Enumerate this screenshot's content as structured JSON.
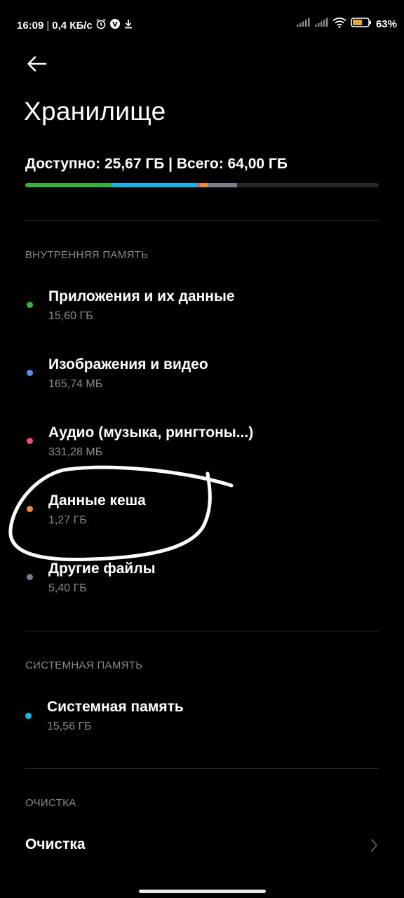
{
  "status_bar": {
    "time": "16:09",
    "speed": "0,4 КБ/с",
    "battery": "63%",
    "battery_level": 0.63,
    "icons": [
      "alarm-icon",
      "vpn-icon",
      "download-icon",
      "signal-icon",
      "signal-icon",
      "wifi-icon",
      "battery-icon"
    ]
  },
  "header": {
    "back_icon": "arrow-left-icon",
    "title": "Хранилище"
  },
  "storage": {
    "summary": "Доступно: 25,67 ГБ | Всего: 64,00 ГБ",
    "bar_segments": [
      {
        "label": "Приложения и их данные",
        "fraction": 0.244,
        "color": "#3aaf3e"
      },
      {
        "label": "Системная память",
        "fraction": 0.243,
        "color": "#19b6e9"
      },
      {
        "label": "Аудио (музыка, рингтоны...)",
        "fraction": 0.005,
        "color": "#e84c87"
      },
      {
        "label": "Изображения и видео",
        "fraction": 0.003,
        "color": "#5b8cf0"
      },
      {
        "label": "Данные кеша",
        "fraction": 0.02,
        "color": "#f08a3c"
      },
      {
        "label": "Другие файлы",
        "fraction": 0.084,
        "color": "#7a7f8c"
      }
    ],
    "bar_track_color": "#262626"
  },
  "sections": {
    "internal": {
      "header": "ВНУТРЕННЯЯ ПАМЯТЬ",
      "items": [
        {
          "name": "Приложения и их данные",
          "size": "15,60 ГБ",
          "color": "#3aaf3e"
        },
        {
          "name": "Изображения и видео",
          "size": "165,74 МБ",
          "color": "#5b8cf0"
        },
        {
          "name": "Аудио (музыка, рингтоны...)",
          "size": "331,28 МБ",
          "color": "#e84c87"
        },
        {
          "name": "Данные кеша",
          "size": "1,27 ГБ",
          "color": "#f08a3c"
        },
        {
          "name": "Другие файлы",
          "size": "5,40 ГБ",
          "color": "#7a7f8c"
        }
      ]
    },
    "system": {
      "header": "СИСТЕМНАЯ ПАМЯТЬ",
      "items": [
        {
          "name": "Системная память",
          "size": "15,56 ГБ",
          "color": "#19b6e9"
        }
      ]
    },
    "cleanup": {
      "header": "ОЧИСТКА",
      "item_label": "Очистка",
      "chevron_icon": "chevron-right-icon"
    }
  },
  "annotation": {
    "type": "hand-drawn-circle",
    "color": "#ffffff",
    "target": "Данные кеша"
  }
}
